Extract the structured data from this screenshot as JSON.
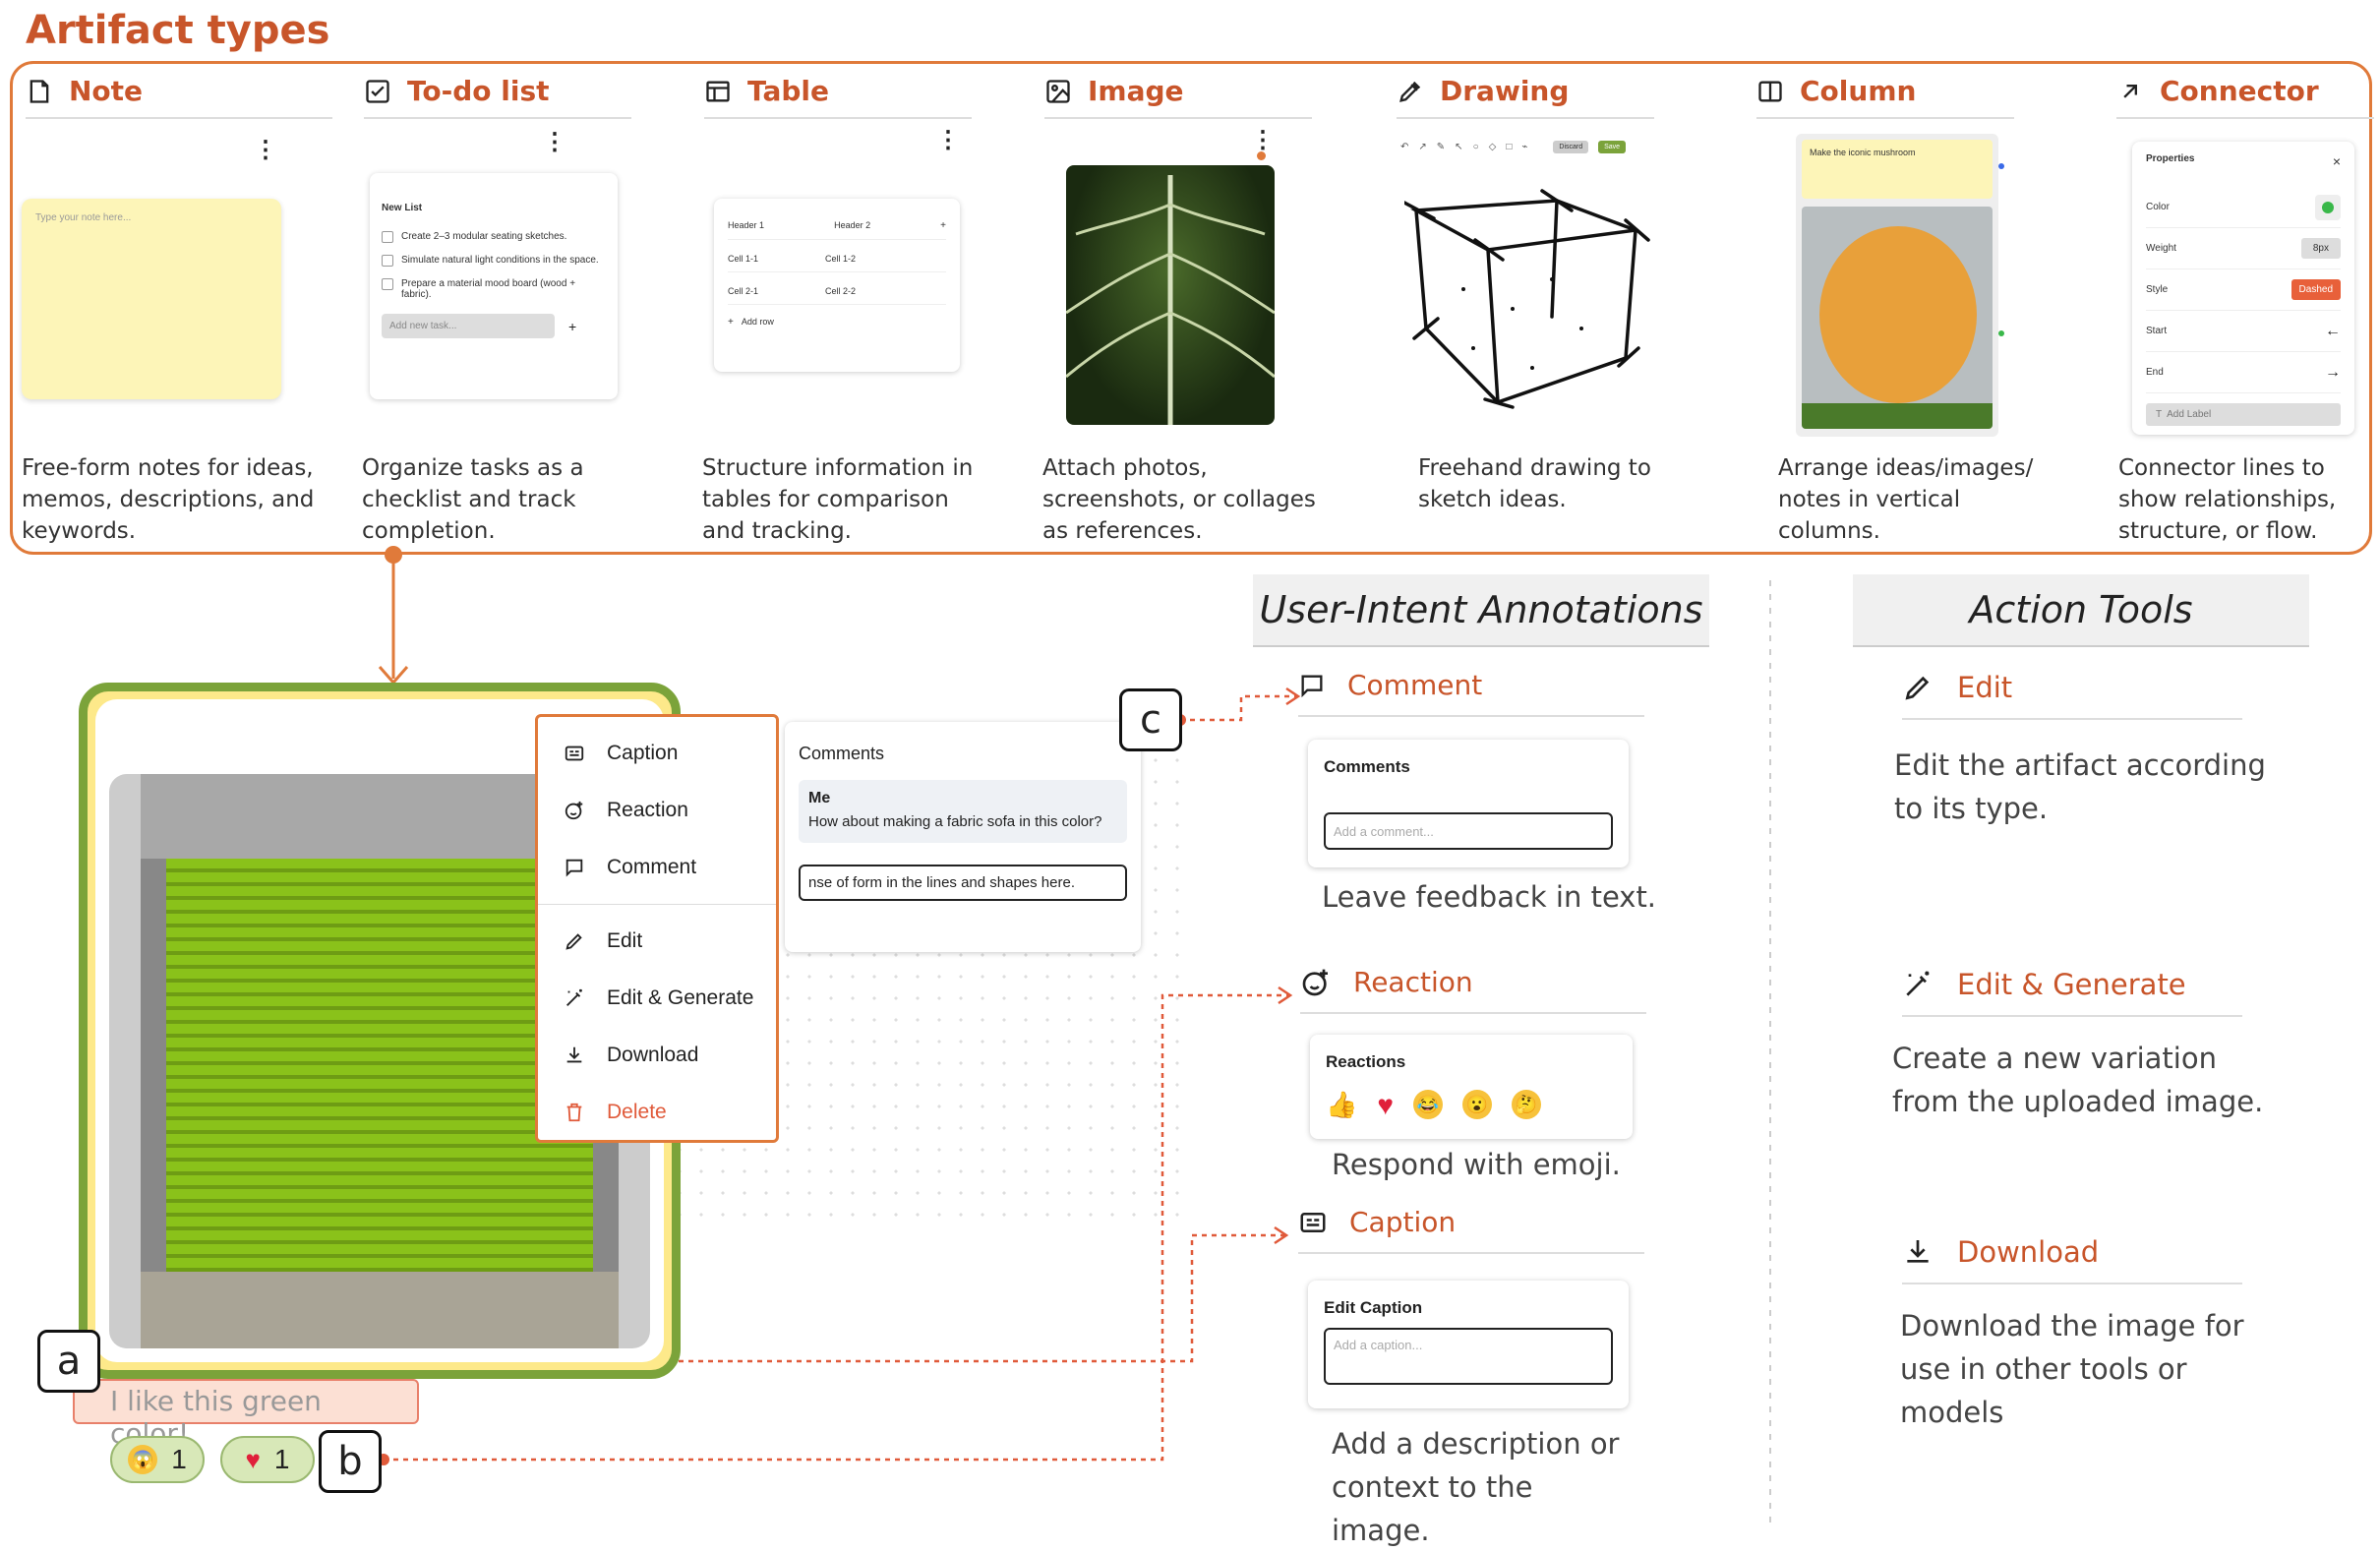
{
  "title": "Artifact types",
  "artifacts": [
    {
      "name": "Note",
      "desc": "Free-form notes for ideas, memos, descriptions, and keywords."
    },
    {
      "name": "To-do list",
      "desc": "Organize tasks as a checklist and track completion."
    },
    {
      "name": "Table",
      "desc": "Structure information in tables for comparison and tracking."
    },
    {
      "name": "Image",
      "desc": "Attach photos, screenshots, or collages as references."
    },
    {
      "name": "Drawing",
      "desc": "Freehand drawing to sketch ideas."
    },
    {
      "name": "Column",
      "desc": "Arrange ideas/images/ notes in vertical columns."
    },
    {
      "name": "Connector",
      "desc": "Connector lines to show relationships, structure, or flow."
    }
  ],
  "note_mock": {
    "placeholder": "Type your note here..."
  },
  "todo_mock": {
    "title": "New List",
    "items": [
      "Create 2–3 modular seating sketches.",
      "Simulate natural light conditions in the space.",
      "Prepare a material mood board (wood + fabric)."
    ],
    "add": "Add new task...",
    "plus": "+"
  },
  "table_mock": {
    "h1": "Header 1",
    "h2": "Header 2",
    "c11": "Cell 1-1",
    "c12": "Cell 1-2",
    "c21": "Cell 2-1",
    "c22": "Cell 2-2",
    "add": "Add row",
    "plus": "+"
  },
  "drawing_mock": {
    "discard": "Discard",
    "save": "Save"
  },
  "column_mock": {
    "note": "Make the iconic mushroom"
  },
  "connector_mock": {
    "title": "Properties",
    "color": "Color",
    "weight": "Weight",
    "weight_val": "8px",
    "style": "Style",
    "style_val": "Dashed",
    "start": "Start",
    "end": "End",
    "add_label": "Add Label",
    "close": "×"
  },
  "menu": {
    "items": [
      "Caption",
      "Reaction",
      "Comment",
      "Edit",
      "Edit & Generate",
      "Download",
      "Delete"
    ]
  },
  "comments_panel": {
    "title": "Comments",
    "author": "Me",
    "text": "How about making a fabric sofa in this color?",
    "input": "nse of form in the lines and shapes here."
  },
  "caption_bubble": "I like this green color!",
  "reactions": [
    {
      "count": "1"
    },
    {
      "count": "1"
    }
  ],
  "labels": {
    "a": "a",
    "b": "b",
    "c": "c"
  },
  "intent_header": "User-Intent Annotations",
  "tools_header": "Action Tools",
  "intent": {
    "comment": {
      "label": "Comment",
      "pane_title": "Comments",
      "placeholder": "Add a comment...",
      "desc": "Leave feedback in text."
    },
    "reaction": {
      "label": "Reaction",
      "pane_title": "Reactions",
      "desc": "Respond with emoji."
    },
    "caption": {
      "label": "Caption",
      "pane_title": "Edit Caption",
      "placeholder": "Add a caption...",
      "desc": "Add a description or context to the image."
    }
  },
  "tools": {
    "edit": {
      "label": "Edit",
      "desc": "Edit the artifact according to its type."
    },
    "editgen": {
      "label": "Edit & Generate",
      "desc": "Create a new variation from the uploaded image."
    },
    "download": {
      "label": "Download",
      "desc": "Download the image for use in other tools or models"
    }
  },
  "colors": {
    "accent": "#c8552a",
    "border": "#e07a3a",
    "green": "#7ba33a",
    "note": "#fdf5b8"
  }
}
